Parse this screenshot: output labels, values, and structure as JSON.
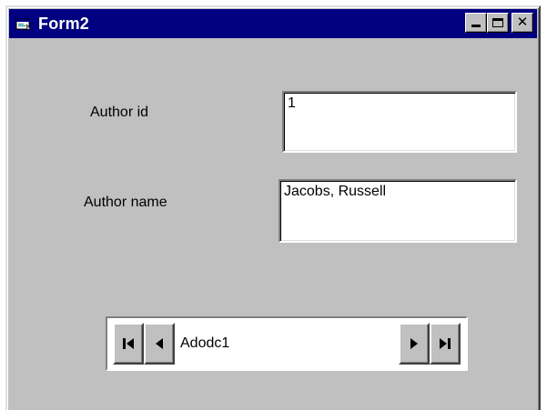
{
  "window": {
    "title": "Form2",
    "title_bar_color": "#000080",
    "face_color": "#c0c0c0",
    "icon": "form-icon"
  },
  "title_buttons": {
    "minimize": "minimize-icon",
    "maximize": "maximize-icon",
    "close": "close-icon"
  },
  "form": {
    "author_id_label": "Author id",
    "author_id_value": "1",
    "author_name_label": "Author name",
    "author_name_value": "Jacobs, Russell"
  },
  "data_control": {
    "caption": "Adodc1",
    "buttons": [
      "move-first-icon",
      "move-previous-icon",
      "move-next-icon",
      "move-last-icon"
    ]
  }
}
